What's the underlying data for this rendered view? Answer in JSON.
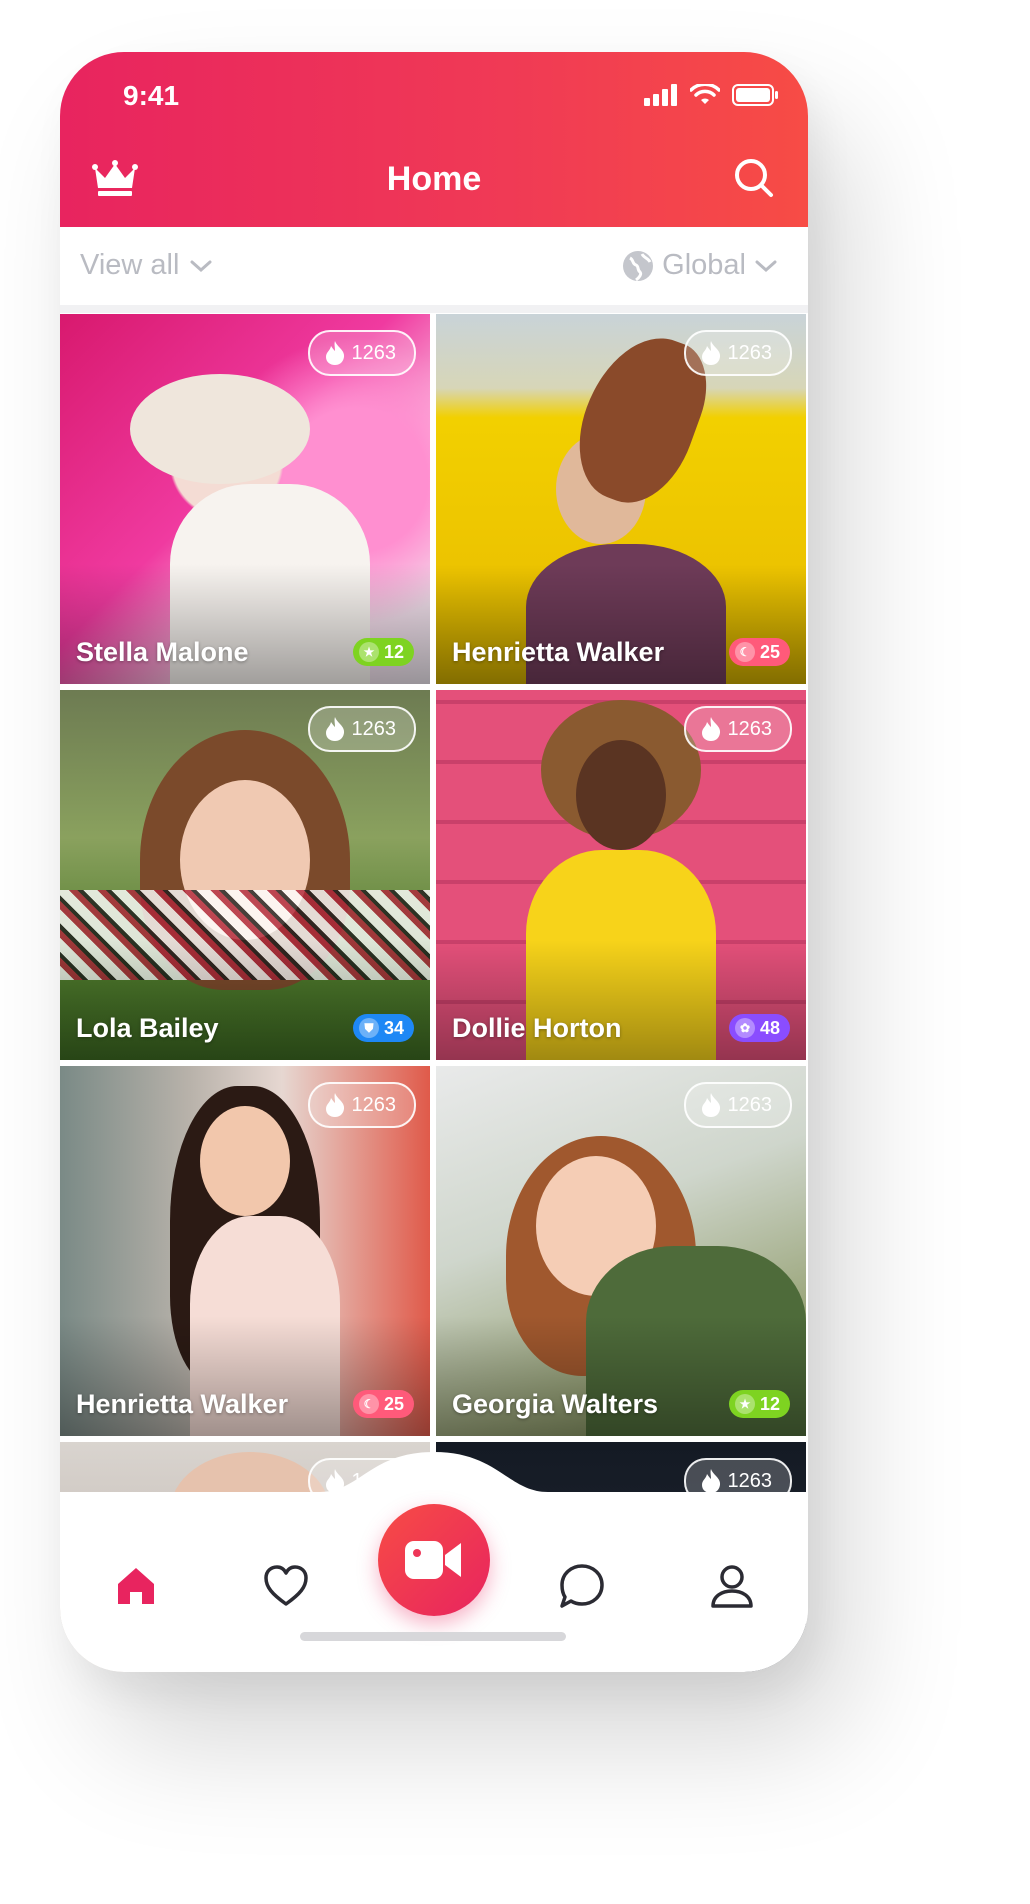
{
  "status_bar": {
    "time": "9:41"
  },
  "header": {
    "title": "Home"
  },
  "filters": {
    "view_all": "View all",
    "region": "Global"
  },
  "cards": [
    {
      "name": "Stella Malone",
      "likes": "1263",
      "badge": "12",
      "badge_type": "star",
      "badge_color": "#7ed321"
    },
    {
      "name": "Henrietta Walker",
      "likes": "1263",
      "badge": "25",
      "badge_type": "moon",
      "badge_color": "#ff5a7a"
    },
    {
      "name": "Lola Bailey",
      "likes": "1263",
      "badge": "34",
      "badge_type": "shield",
      "badge_color": "#1e88f5"
    },
    {
      "name": "Dollie Horton",
      "likes": "1263",
      "badge": "48",
      "badge_type": "paw",
      "badge_color": "#8a4dff"
    },
    {
      "name": "Henrietta Walker",
      "likes": "1263",
      "badge": "25",
      "badge_type": "moon",
      "badge_color": "#ff5a7a"
    },
    {
      "name": "Georgia Walters",
      "likes": "1263",
      "badge": "12",
      "badge_type": "star",
      "badge_color": "#7ed321"
    },
    {
      "name": "",
      "likes": "1263"
    },
    {
      "name": "",
      "likes": "1263"
    }
  ],
  "tabbar": {
    "items": [
      "home-icon",
      "heart-icon",
      "video-camera-icon",
      "chat-icon",
      "profile-icon"
    ],
    "active_color": "#e8245f"
  },
  "colors": {
    "brand_start": "#e8245f",
    "brand_end": "#f74c45",
    "muted_text": "#b9bbc2"
  }
}
